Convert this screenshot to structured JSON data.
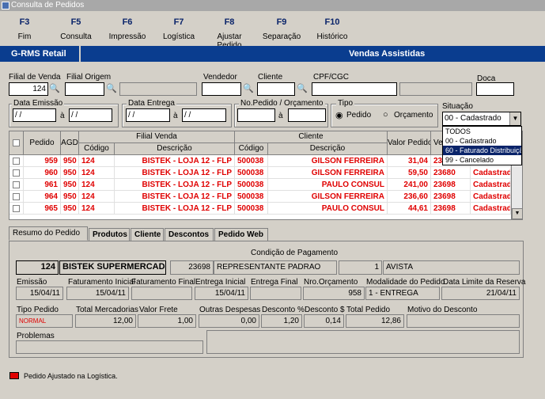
{
  "window": {
    "title": "Consulta de Pedidos"
  },
  "toolbar": [
    {
      "key": "F3",
      "label": "Fim"
    },
    {
      "key": "F5",
      "label": "Consulta"
    },
    {
      "key": "F6",
      "label": "Impressão"
    },
    {
      "key": "F7",
      "label": "Logística"
    },
    {
      "key": "F8",
      "label": "Ajustar Pedido"
    },
    {
      "key": "F9",
      "label": "Separação"
    },
    {
      "key": "F10",
      "label": "Histórico"
    }
  ],
  "banner": {
    "left": "G-RMS Retail",
    "right": "Vendas Assistidas"
  },
  "filters": {
    "filial_venda_label": "Filial de Venda",
    "filial_venda": "124",
    "filial_origem_label": "Filial Origem",
    "vendedor_label": "Vendedor",
    "cliente_label": "Cliente",
    "cpf_label": "CPF/CGC",
    "doca_label": "Doca",
    "emissao_label": "Data Emissão",
    "entrega_label": "Data Entrega",
    "pedido_label": "No.Pedido / Orçamento",
    "tipo_label": "Tipo",
    "situacao_label": "Situação",
    "date_placeholder": "/ /",
    "a": "à",
    "tipo_pedido": "Pedido",
    "tipo_orcamento": "Orçamento",
    "situacao_value": "00 - Cadastrado"
  },
  "situacao_options": [
    "TODOS",
    "00 - Cadastrado",
    "60 - Faturado Distribuição",
    "99 - Cancelado"
  ],
  "grid": {
    "headers": {
      "pedido": "Pedido",
      "agd": "AGD",
      "filial_venda": "Filial Venda",
      "codigo": "Código",
      "descricao": "Descrição",
      "cliente": "Cliente",
      "valor": "Valor Pedido",
      "ve": "Ve"
    },
    "rows": [
      {
        "pedido": "959",
        "agd": "950",
        "filial": "124",
        "filial_desc": "BISTEK - LOJA 12 - FLP",
        "cli": "500038",
        "cli_desc": "GILSON FERREIRA",
        "valor": "31,04",
        "vend": "23698",
        "sit": "Cadastrad"
      },
      {
        "pedido": "960",
        "agd": "950",
        "filial": "124",
        "filial_desc": "BISTEK - LOJA 12 - FLP",
        "cli": "500038",
        "cli_desc": "GILSON FERREIRA",
        "valor": "59,50",
        "vend": "23680",
        "sit": "Cadastrad"
      },
      {
        "pedido": "961",
        "agd": "950",
        "filial": "124",
        "filial_desc": "BISTEK - LOJA 12 - FLP",
        "cli": "500038",
        "cli_desc": "PAULO CONSUL",
        "valor": "241,00",
        "vend": "23698",
        "sit": "Cadastrad"
      },
      {
        "pedido": "964",
        "agd": "950",
        "filial": "124",
        "filial_desc": "BISTEK - LOJA 12 - FLP",
        "cli": "500038",
        "cli_desc": "GILSON FERREIRA",
        "valor": "236,60",
        "vend": "23698",
        "sit": "Cadastrad"
      },
      {
        "pedido": "965",
        "agd": "950",
        "filial": "124",
        "filial_desc": "BISTEK - LOJA 12 - FLP",
        "cli": "500038",
        "cli_desc": "PAULO CONSUL",
        "valor": "44,61",
        "vend": "23698",
        "sit": "Cadastrad"
      }
    ]
  },
  "tabs": [
    "Resumo do Pedido",
    "Produtos",
    "Cliente",
    "Descontos",
    "Pedido Web"
  ],
  "detail": {
    "cond_pag_label": "Condição de Pagamento",
    "filial_num": "124",
    "filial_nome": "BISTEK SUPERMERCADOS LTDA",
    "vend_cod": "23698",
    "vend_nome": "REPRESENTANTE PADRAO",
    "cond_cod": "1",
    "cond_desc": "AVISTA",
    "emissao_label": "Emissão",
    "emissao": "15/04/11",
    "fat_ini_label": "Faturamento Inicial",
    "fat_ini": "15/04/11",
    "fat_fim_label": "Faturamento Final",
    "ent_ini_label": "Entrega Inicial",
    "ent_ini": "15/04/11",
    "ent_fim_label": "Entrega Final",
    "orc_label": "Nro.Orçamento",
    "orc": "958",
    "mod_label": "Modalidade do Pedido",
    "mod": "1 - ENTREGA",
    "lim_label": "Data Limite da Reserva",
    "lim": "21/04/11",
    "tipo_label": "Tipo Pedido",
    "tipo": "NORMAL",
    "tot_merc_label": "Total Mercadorias",
    "tot_merc": "12,00",
    "frete_label": "Valor Frete",
    "frete": "1,00",
    "outras_label": "Outras Despesas",
    "outras": "0,00",
    "desc_pct_label": "Desconto %",
    "desc_pct": "1,20",
    "desc_val_label": "Desconto $",
    "desc_val": "0,14",
    "tot_ped_label": "Total Pedido",
    "tot_ped": "12,86",
    "motivo_label": "Motivo do Desconto",
    "problemas_label": "Problemas"
  },
  "legend": {
    "text": "Pedido Ajustado na Logística.",
    "color": "#e00000"
  }
}
